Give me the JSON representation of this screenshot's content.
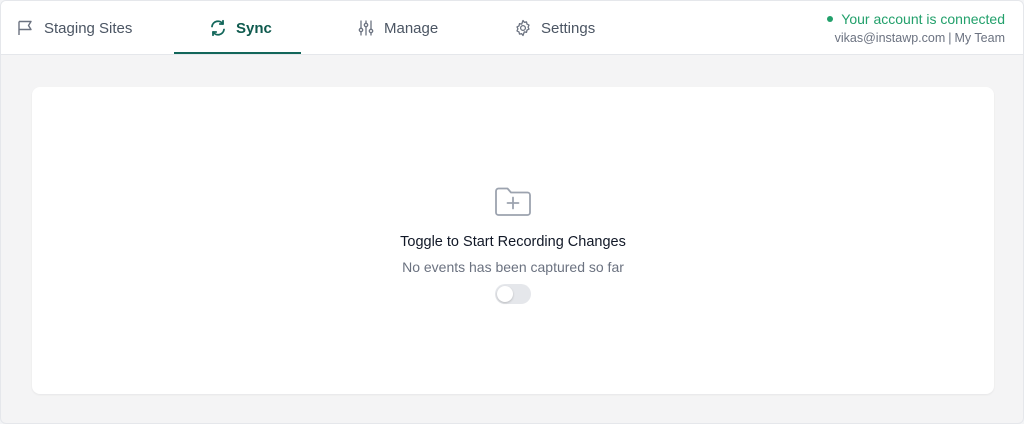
{
  "tabs": [
    {
      "label": "Staging Sites",
      "icon": "flag-icon"
    },
    {
      "label": "Sync",
      "icon": "sync-icon",
      "active": true
    },
    {
      "label": "Manage",
      "icon": "sliders-icon"
    },
    {
      "label": "Settings",
      "icon": "gear-icon"
    }
  ],
  "account": {
    "status": "Your account is connected",
    "email": "vikas@instawp.com",
    "separator": "|",
    "team": "My Team",
    "status_color": "#22a06b"
  },
  "empty_state": {
    "icon": "folder-plus-icon",
    "title": "Toggle to Start Recording Changes",
    "subtitle": "No events has been captured so far",
    "toggle_on": false
  },
  "colors": {
    "accent": "#12665a"
  }
}
